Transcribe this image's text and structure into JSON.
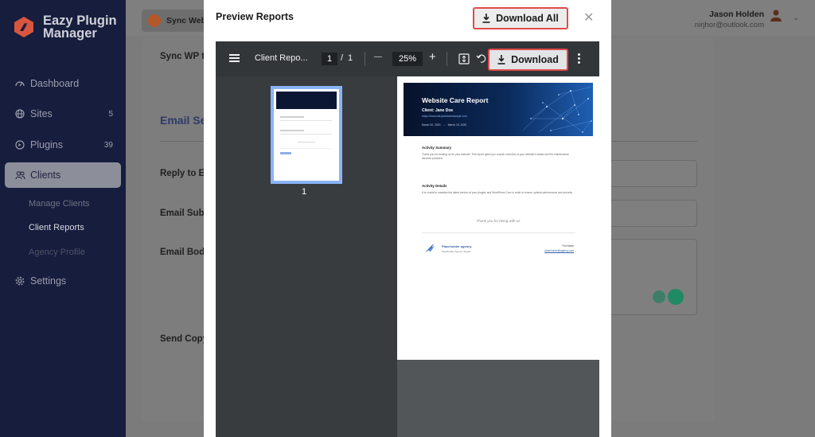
{
  "brand": {
    "line1": "Eazy Plugin",
    "line2": "Manager"
  },
  "sidebar": {
    "items": [
      {
        "label": "Dashboard",
        "icon": "dashboard-icon"
      },
      {
        "label": "Sites",
        "icon": "globe-icon",
        "count": "5"
      },
      {
        "label": "Plugins",
        "icon": "plugin-icon",
        "count": "39"
      },
      {
        "label": "Clients",
        "icon": "users-icon"
      },
      {
        "label": "Settings",
        "icon": "gear-icon"
      }
    ],
    "sub_items": [
      {
        "label": "Manage Clients"
      },
      {
        "label": "Client Reports"
      },
      {
        "label": "Agency Profile"
      }
    ]
  },
  "topbar": {
    "sync_label": "Sync Website",
    "user_name": "Jason Holden",
    "user_email": "nirjhor@outlook.com"
  },
  "background_form": {
    "sync_label": "Sync WP to",
    "section_heading": "Email Se",
    "reply_label": "Reply to Em",
    "subject_label": "Email Subje",
    "body_label": "Email Body",
    "send_copy_label": "Send Copy"
  },
  "modal": {
    "title": "Preview Reports",
    "download_all_label": "Download All",
    "close_glyph": "✕"
  },
  "viewer": {
    "doc_title": "Client Repo...",
    "page_current": "1",
    "page_separator": "/",
    "page_total": "1",
    "zoom": "25%",
    "minus_glyph": "—",
    "plus_glyph": "+",
    "download_label": "Download",
    "thumb_number": "1"
  },
  "report": {
    "title": "Website Care Report",
    "client": "Client: Jane Doe",
    "url": "https://www.site.janedoeexample.com",
    "date_from": "March 20, 2020",
    "date_to": "March 15, 2020",
    "summary_title": "Activity Summary",
    "summary_body": "Thank you for trusting us for your website. This report gives you a quick overview of your website's status and the maintenance services provided.",
    "details_title": "Activity Details",
    "details_body": "It is crucial to maintain the latest version of your plugins and WordPress Core in order to ensure optimal performance and security.",
    "thanks": "Thank you for being with us",
    "agency_name": "Placeholder agency",
    "agency_sub": "Placeholder Agency Slogan",
    "contact_name": "Full Name",
    "contact_email": "placeholder@agency.com"
  },
  "colors": {
    "sidebar_bg": "#171d3d",
    "accent_red": "#e14b4b",
    "thumb_border": "#8ab4f8"
  }
}
